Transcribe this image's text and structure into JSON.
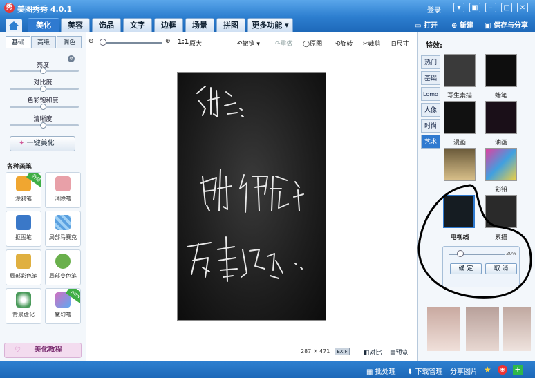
{
  "window": {
    "title": "美图秀秀 4.0.1",
    "logo_text": "秀",
    "login": "登录"
  },
  "tabs": [
    "美化",
    "美容",
    "饰品",
    "文字",
    "边框",
    "场景",
    "拼图",
    "更多功能"
  ],
  "top_actions": {
    "open": "打开",
    "new": "新建",
    "save_share": "保存与分享"
  },
  "left_panel": {
    "subtabs": [
      "基础",
      "高级",
      "调色"
    ],
    "sliders": [
      {
        "label": "亮度",
        "value": 0.5
      },
      {
        "label": "对比度",
        "value": 0.5
      },
      {
        "label": "色彩饱和度",
        "value": 0.5
      },
      {
        "label": "清晰度",
        "value": 0.5
      }
    ],
    "one_click": "一键美化",
    "brushes_title": "各种画笔",
    "tools": [
      {
        "label": "涂鸦笔",
        "badge": "升级",
        "color": "#f0a630"
      },
      {
        "label": "消除笔",
        "badge": "",
        "color": "#e8a0a8"
      },
      {
        "label": "抠图笔",
        "badge": "",
        "color": "#3a78c8"
      },
      {
        "label": "局部马赛克",
        "badge": "",
        "color": "#5aa0e0"
      },
      {
        "label": "局部彩色笔",
        "badge": "",
        "color": "#e0b040"
      },
      {
        "label": "局部变色笔",
        "badge": "",
        "color": "#6ab04c"
      },
      {
        "label": "背景虚化",
        "badge": "",
        "color": "#4a9a5a"
      },
      {
        "label": "魔幻笔",
        "badge": "new",
        "color": "#d070c0"
      }
    ],
    "tutorial": "美化教程"
  },
  "canvas": {
    "toolbar": {
      "ratio": "1:1",
      "original_size": "原大",
      "undo": "撤销",
      "redo": "重做",
      "original": "原图",
      "rotate": "旋转",
      "crop": "裁剪",
      "resize": "尺寸"
    },
    "image_width": "287",
    "image_height": "471",
    "exif": "EXIF",
    "compare": "对比",
    "preview": "预览"
  },
  "right_panel": {
    "title": "特效:",
    "categories": [
      "热门",
      "基础",
      "Lomo",
      "人像",
      "时尚",
      "艺术"
    ],
    "active_category": "艺术",
    "effects": [
      "写生素描",
      "蜡笔",
      "漫画",
      "油画",
      "",
      "彩铅",
      "电视线",
      "素描"
    ],
    "popup": {
      "percent": "20%",
      "confirm": "确 定",
      "cancel": "取 消",
      "value": 0.2
    }
  },
  "statusbar": {
    "batch": "批处理",
    "download": "下载管理",
    "share_pic": "分享图片"
  },
  "colors": {
    "brand_blue": "#2d7fd0",
    "photo_bg": "#151515"
  }
}
